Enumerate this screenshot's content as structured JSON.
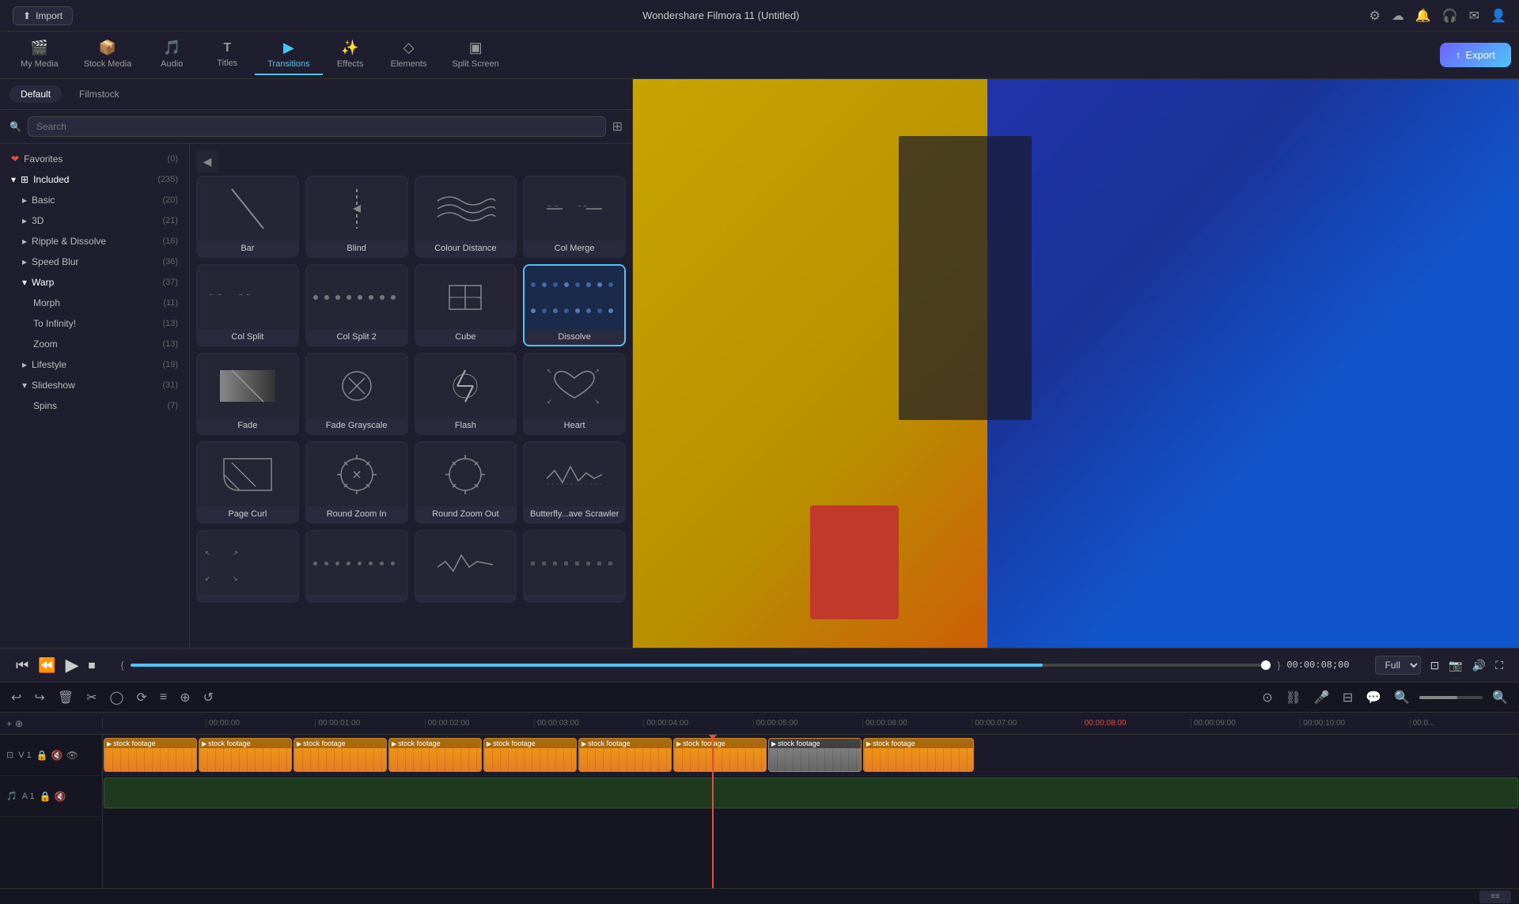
{
  "app": {
    "title": "Wondershare Filmora 11 (Untitled)",
    "import_label": "Import"
  },
  "nav": {
    "tabs": [
      {
        "id": "my-media",
        "label": "My Media",
        "icon": "🎬"
      },
      {
        "id": "stock-media",
        "label": "Stock Media",
        "icon": "📦"
      },
      {
        "id": "audio",
        "label": "Audio",
        "icon": "🎵"
      },
      {
        "id": "titles",
        "label": "Titles",
        "icon": "T"
      },
      {
        "id": "transitions",
        "label": "Transitions",
        "icon": "▶"
      },
      {
        "id": "effects",
        "label": "Effects",
        "icon": "✨"
      },
      {
        "id": "elements",
        "label": "Elements",
        "icon": "◇"
      },
      {
        "id": "split-screen",
        "label": "Split Screen",
        "icon": "▣"
      }
    ],
    "export_label": "Export",
    "active_tab": "transitions"
  },
  "left_panel": {
    "tabs": [
      "Default",
      "Filmstock"
    ],
    "active_tab": "Default",
    "search_placeholder": "Search"
  },
  "sidebar": {
    "items": [
      {
        "id": "favorites",
        "label": "Favorites",
        "count": "(0)",
        "icon": "❤",
        "indent": 0,
        "expanded": false
      },
      {
        "id": "included",
        "label": "Included",
        "count": "(235)",
        "indent": 0,
        "expanded": true
      },
      {
        "id": "basic",
        "label": "Basic",
        "count": "(20)",
        "indent": 1
      },
      {
        "id": "3d",
        "label": "3D",
        "count": "(21)",
        "indent": 1
      },
      {
        "id": "ripple",
        "label": "Ripple & Dissolve",
        "count": "(16)",
        "indent": 1
      },
      {
        "id": "speed-blur",
        "label": "Speed Blur",
        "count": "(36)",
        "indent": 1
      },
      {
        "id": "warp",
        "label": "Warp",
        "count": "(37)",
        "indent": 1,
        "expanded": true
      },
      {
        "id": "morph",
        "label": "Morph",
        "count": "(11)",
        "indent": 2
      },
      {
        "id": "to-infinity",
        "label": "To Infinity!",
        "count": "(13)",
        "indent": 2
      },
      {
        "id": "zoom",
        "label": "Zoom",
        "count": "(13)",
        "indent": 2
      },
      {
        "id": "lifestyle",
        "label": "Lifestyle",
        "count": "(19)",
        "indent": 1
      },
      {
        "id": "slideshow",
        "label": "Slideshow",
        "count": "(31)",
        "indent": 1,
        "expanded": false
      },
      {
        "id": "spins",
        "label": "Spins",
        "count": "(7)",
        "indent": 2
      }
    ]
  },
  "transitions": [
    {
      "id": "bar",
      "label": "Bar",
      "thumb_type": "bar"
    },
    {
      "id": "blind",
      "label": "Blind",
      "thumb_type": "blind"
    },
    {
      "id": "colour-distance",
      "label": "Colour Distance",
      "thumb_type": "colour-distance"
    },
    {
      "id": "col-merge",
      "label": "Col Merge",
      "thumb_type": "col-merge"
    },
    {
      "id": "col-split",
      "label": "Col Split",
      "thumb_type": "col-split"
    },
    {
      "id": "col-split-2",
      "label": "Col Split 2",
      "thumb_type": "col-split-2"
    },
    {
      "id": "cube",
      "label": "Cube",
      "thumb_type": "cube"
    },
    {
      "id": "dissolve",
      "label": "Dissolve",
      "thumb_type": "dissolve",
      "selected": true
    },
    {
      "id": "fade",
      "label": "Fade",
      "thumb_type": "fade"
    },
    {
      "id": "fade-grayscale",
      "label": "Fade Grayscale",
      "thumb_type": "fade-grayscale"
    },
    {
      "id": "flash",
      "label": "Flash",
      "thumb_type": "flash"
    },
    {
      "id": "heart",
      "label": "Heart",
      "thumb_type": "heart"
    },
    {
      "id": "page-curl",
      "label": "Page Curl",
      "thumb_type": "page-curl"
    },
    {
      "id": "round-zoom-in",
      "label": "Round Zoom In",
      "thumb_type": "round-zoom-in"
    },
    {
      "id": "round-zoom-out",
      "label": "Round Zoom Out",
      "thumb_type": "round-zoom-out"
    },
    {
      "id": "butterfly-scrawler",
      "label": "Butterfly...ave Scrawler",
      "thumb_type": "butterfly"
    }
  ],
  "playback": {
    "time_display": "00:00:08;00",
    "quality": "Full",
    "progress_pct": 80
  },
  "timeline": {
    "track1_label": "V 1",
    "track2_label": "A 1",
    "timestamps": [
      "00:00:00",
      "00:00:01:00",
      "00:00:02:00",
      "00:00:03:00",
      "00:00:04:00",
      "00:00:05:00",
      "00:00:06:00",
      "00:00:07:00",
      "00:00:08:00",
      "00:00:09:00",
      "00:00:10:00",
      "00:0..."
    ],
    "clips": [
      "stock footage",
      "stock footage",
      "stock footage",
      "stock footage",
      "stock footage",
      "stock footage",
      "stock footage",
      "stock footage",
      "stock footage"
    ]
  }
}
